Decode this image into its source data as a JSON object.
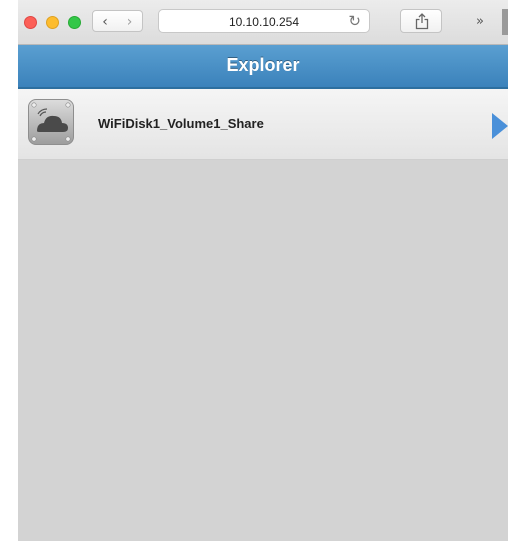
{
  "browser": {
    "back_glyph": "‹",
    "forward_glyph": "›",
    "address": "10.10.10.254",
    "reload_glyph": "↻",
    "more_glyph": "»",
    "share_icon": "share-icon"
  },
  "app": {
    "title": "Explorer",
    "header_color": "#4a90c8"
  },
  "list": {
    "items": [
      {
        "label": "WiFiDisk1_Volume1_Share",
        "icon": "cloud-drive-icon"
      }
    ],
    "chevron_color": "#4a90d9"
  }
}
